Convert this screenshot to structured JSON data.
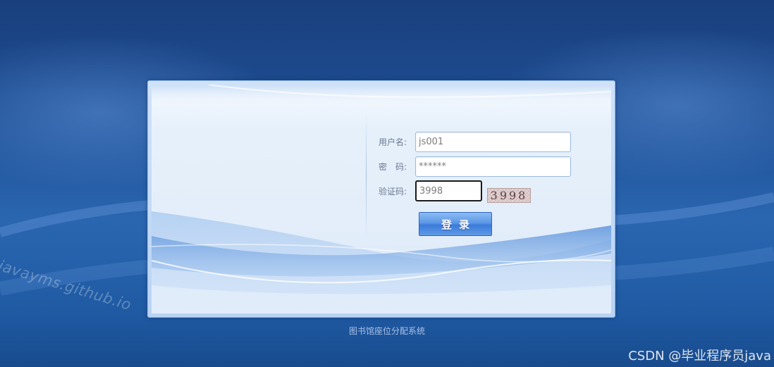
{
  "watermark": {
    "left_text": "javayms.github.io",
    "corner_text": "CSDN @毕业程序员java"
  },
  "login_form": {
    "username_label": "用户名:",
    "username_value": "js001",
    "password_label": "密　码:",
    "password_value": "******",
    "captcha_label": "验证码:",
    "captcha_value": "3998",
    "captcha_image_text": "3998",
    "submit_label": "登录"
  },
  "footer": {
    "system_name": "图书馆座位分配系统"
  },
  "colors": {
    "background": "#1d4e93",
    "panel": "#e4eefa",
    "button": "#3c7bd9",
    "label": "#6b7890"
  }
}
